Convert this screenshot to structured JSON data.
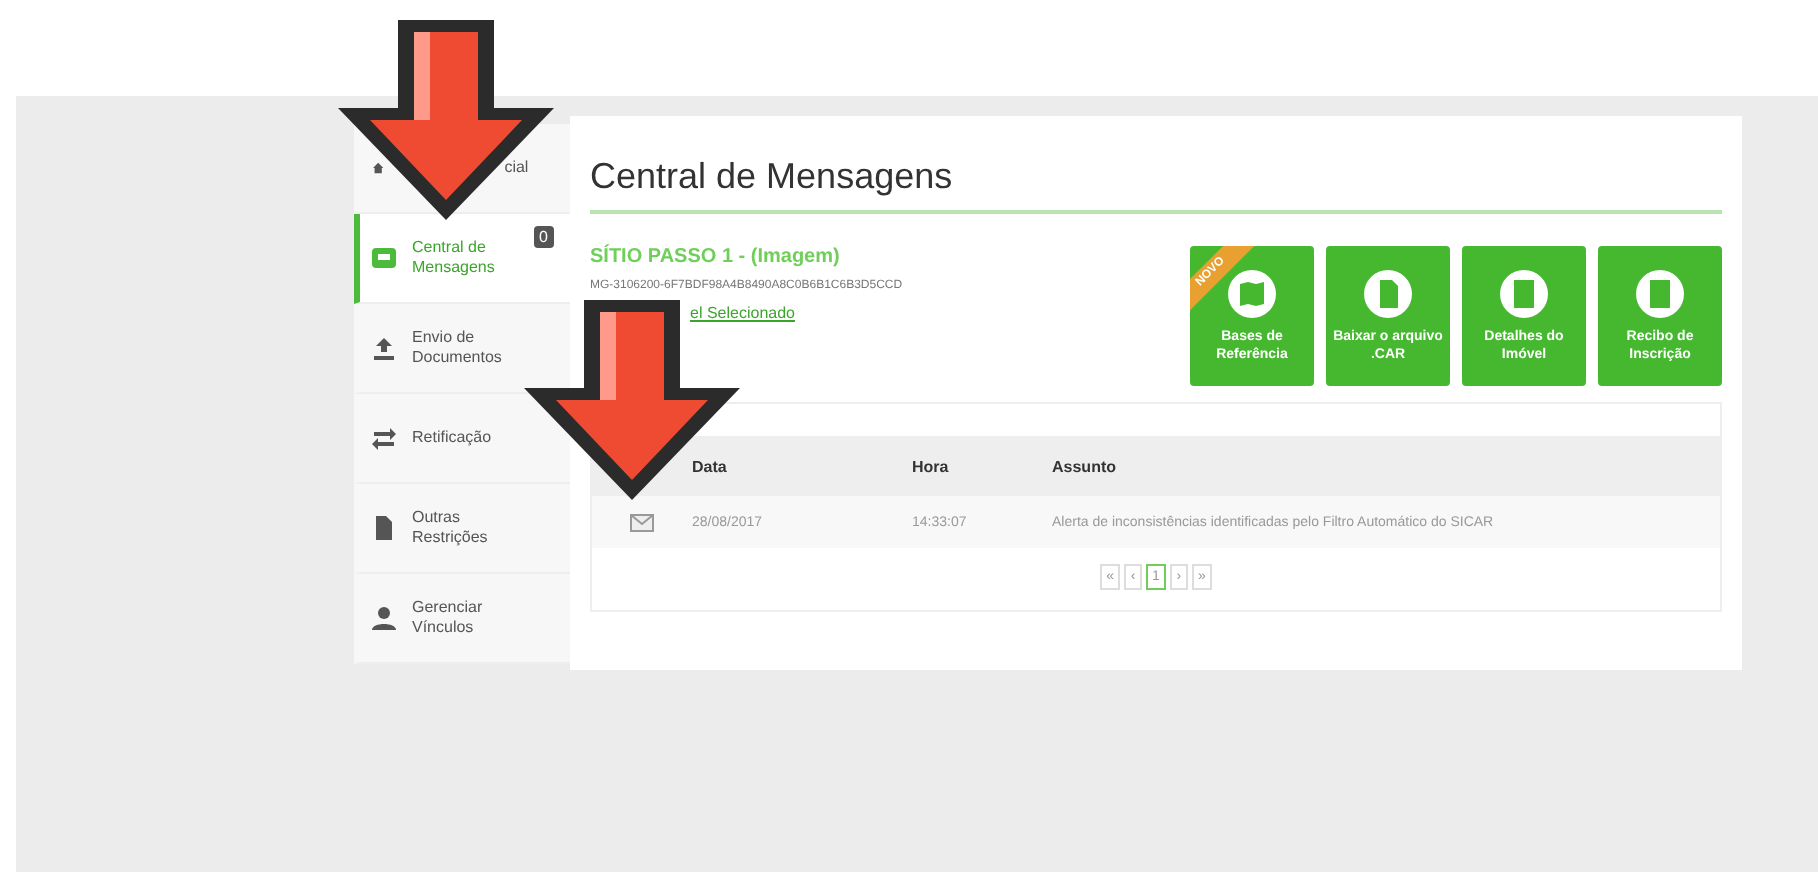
{
  "sidebar": {
    "items": [
      {
        "label": "cial",
        "selected": false
      },
      {
        "label": "Central de Mensagens",
        "selected": true,
        "badge": "0"
      },
      {
        "label": "Envio de Documentos",
        "selected": false
      },
      {
        "label": "Retificação",
        "selected": false
      },
      {
        "label": "Outras Restrições",
        "selected": false
      },
      {
        "label": "Gerenciar Vínculos",
        "selected": false
      }
    ]
  },
  "page": {
    "title": "Central de Mensagens",
    "property_name": "SÍTIO PASSO 1 - (Imagem)",
    "property_code": "MG-3106200-6F7BDF98A4B8490A8C0B6B1C6B3D5CCD",
    "change_link": "el Selecionado"
  },
  "actions": [
    {
      "label": "Bases de Referência",
      "ribbon": "NOVO"
    },
    {
      "label": "Baixar o arquivo .CAR"
    },
    {
      "label": "Detalhes do Imóvel"
    },
    {
      "label": "Recibo de Inscrição"
    }
  ],
  "table": {
    "columns": [
      "Data",
      "Hora",
      "Assunto"
    ],
    "rows": [
      {
        "date": "28/08/2017",
        "time": "14:33:07",
        "subject": "Alerta de inconsistências identificadas pelo Filtro Automático do SICAR"
      }
    ]
  },
  "pagination": [
    {
      "label": "«",
      "selected": false
    },
    {
      "label": "‹",
      "selected": false
    },
    {
      "label": "1",
      "selected": true
    },
    {
      "label": "›",
      "selected": false
    },
    {
      "label": "»",
      "selected": false
    }
  ],
  "arrows": [
    {
      "kind": "arrow"
    },
    {
      "kind": "arrow"
    }
  ]
}
